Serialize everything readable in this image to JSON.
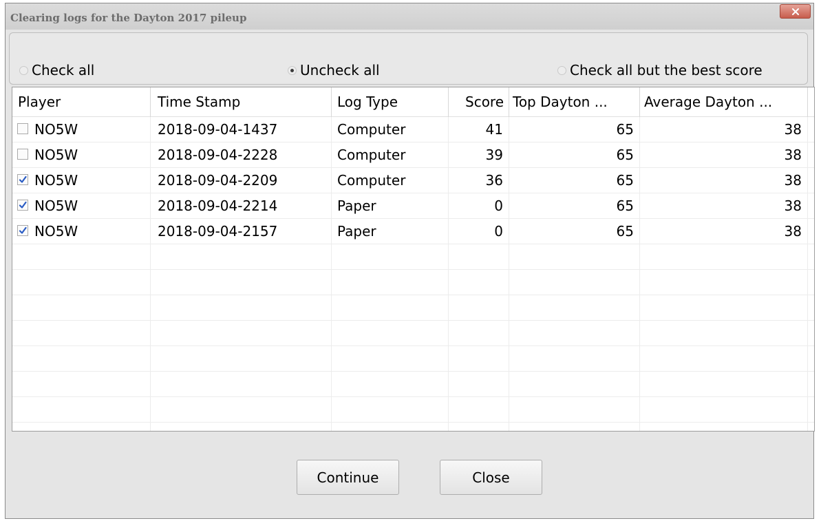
{
  "window": {
    "title": "Clearing logs for the Dayton 2017 pileup"
  },
  "options": {
    "check_all": "Check all",
    "uncheck_all": "Uncheck all",
    "check_all_but_best": "Check all but the best score",
    "selected": "uncheck_all"
  },
  "table": {
    "columns": [
      "Player",
      "Time Stamp",
      "Log Type",
      "Score",
      "Top Dayton ...",
      "Average Dayton ..."
    ],
    "rows": [
      {
        "checked": false,
        "player": "NO5W",
        "timestamp": "2018-09-04-1437",
        "log_type": "Computer",
        "score": "41",
        "top": "65",
        "avg": "38"
      },
      {
        "checked": false,
        "player": "NO5W",
        "timestamp": "2018-09-04-2228",
        "log_type": "Computer",
        "score": "39",
        "top": "65",
        "avg": "38"
      },
      {
        "checked": true,
        "player": "NO5W",
        "timestamp": "2018-09-04-2209",
        "log_type": "Computer",
        "score": "36",
        "top": "65",
        "avg": "38"
      },
      {
        "checked": true,
        "player": "NO5W",
        "timestamp": "2018-09-04-2214",
        "log_type": "Paper",
        "score": "0",
        "top": "65",
        "avg": "38"
      },
      {
        "checked": true,
        "player": "NO5W",
        "timestamp": "2018-09-04-2157",
        "log_type": "Paper",
        "score": "0",
        "top": "65",
        "avg": "38"
      }
    ]
  },
  "buttons": {
    "continue": "Continue",
    "close": "Close"
  },
  "colors": {
    "close_button": "#c75d4d",
    "checkmark": "#2a5cc4"
  }
}
